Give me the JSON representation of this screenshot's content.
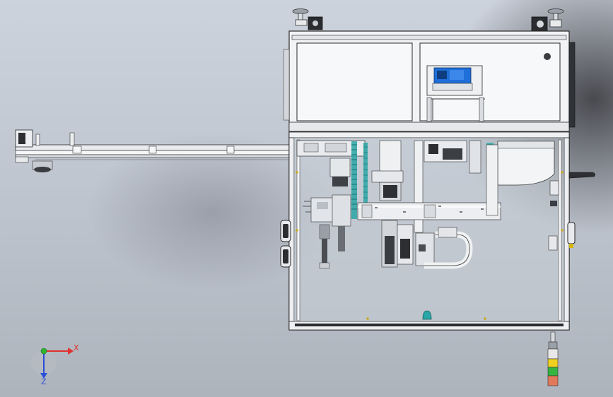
{
  "viewport": {
    "background_top": "#cdd3dd",
    "background_bottom": "#aeb4bc"
  },
  "triad": {
    "x_label": "X",
    "z_label": "Z",
    "x_color": "#e0322e",
    "z_color": "#2b4fd6",
    "y_color": "#2fb52f"
  },
  "colors": {
    "frame": "#f2f3f5",
    "frame_stroke": "#2a2a2a",
    "motor_blue": "#1e6fd9",
    "drag_chain_teal": "#2aa6a6",
    "tower_light": [
      "#e53030",
      "#f0d020",
      "#33b540",
      "#e8e8e8"
    ]
  }
}
